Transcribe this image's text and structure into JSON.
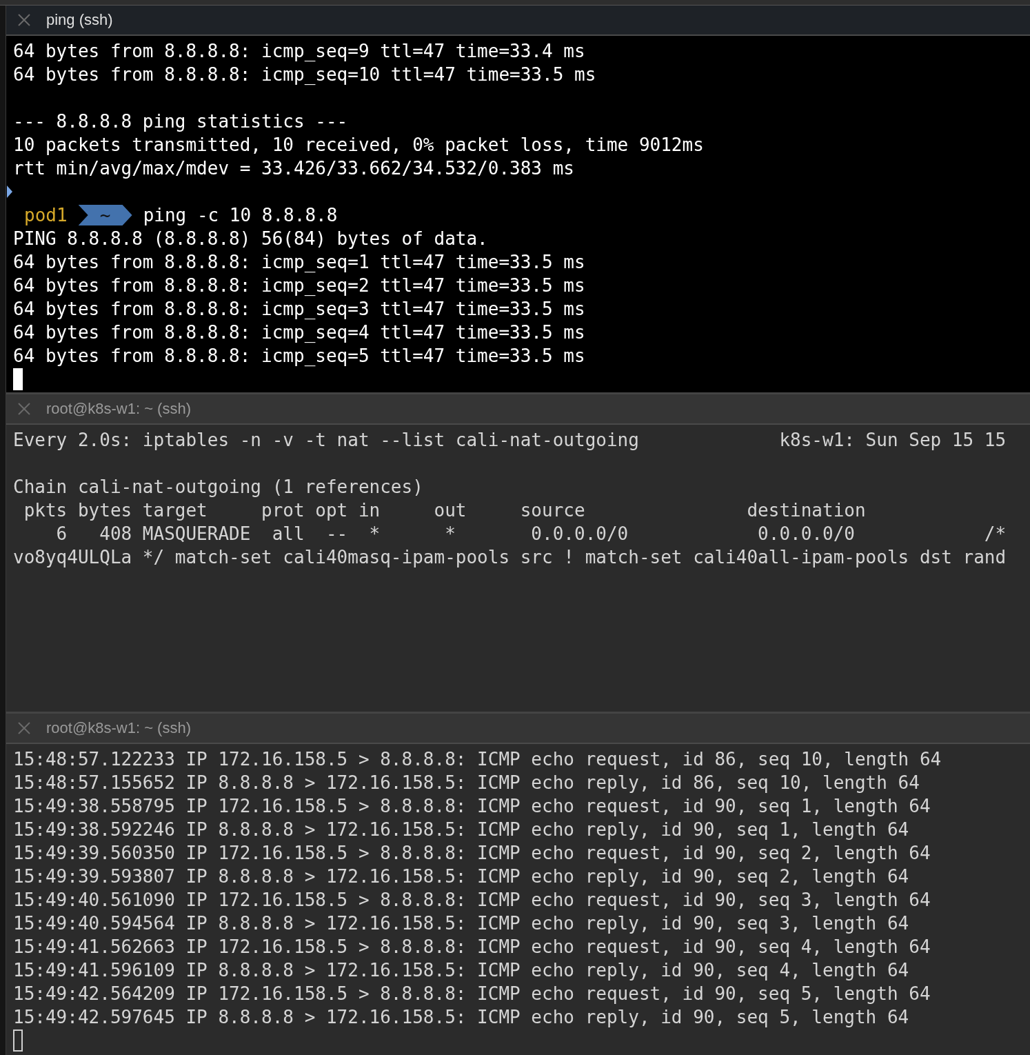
{
  "panes": [
    {
      "title": "ping (ssh)",
      "focused": true,
      "cursor": true,
      "lines": [
        {
          "kind": "text",
          "text": "64 bytes from 8.8.8.8: icmp_seq=9 ttl=47 time=33.4 ms"
        },
        {
          "kind": "text",
          "text": "64 bytes from 8.8.8.8: icmp_seq=10 ttl=47 time=33.5 ms"
        },
        {
          "kind": "blank"
        },
        {
          "kind": "text",
          "text": "--- 8.8.8.8 ping statistics ---"
        },
        {
          "kind": "text",
          "text": "10 packets transmitted, 10 received, 0% packet loss, time 9012ms"
        },
        {
          "kind": "text",
          "text": "rtt min/avg/max/mdev = 33.426/33.662/34.532/0.383 ms"
        },
        {
          "kind": "mark"
        },
        {
          "kind": "prompt",
          "host": "pod1",
          "dir": "~",
          "text": "ping -c 10 8.8.8.8"
        },
        {
          "kind": "text",
          "text": "PING 8.8.8.8 (8.8.8.8) 56(84) bytes of data."
        },
        {
          "kind": "text",
          "text": "64 bytes from 8.8.8.8: icmp_seq=1 ttl=47 time=33.5 ms"
        },
        {
          "kind": "text",
          "text": "64 bytes from 8.8.8.8: icmp_seq=2 ttl=47 time=33.5 ms"
        },
        {
          "kind": "text",
          "text": "64 bytes from 8.8.8.8: icmp_seq=3 ttl=47 time=33.5 ms"
        },
        {
          "kind": "text",
          "text": "64 bytes from 8.8.8.8: icmp_seq=4 ttl=47 time=33.5 ms"
        },
        {
          "kind": "text",
          "text": "64 bytes from 8.8.8.8: icmp_seq=5 ttl=47 time=33.5 ms"
        }
      ]
    },
    {
      "title": "root@k8s-w1: ~ (ssh)",
      "focused": false,
      "cursor": false,
      "lines": [
        {
          "kind": "text",
          "text": "Every 2.0s: iptables -n -v -t nat --list cali-nat-outgoing             k8s-w1: Sun Sep 15 15"
        },
        {
          "kind": "blank"
        },
        {
          "kind": "text",
          "text": "Chain cali-nat-outgoing (1 references)"
        },
        {
          "kind": "text",
          "text": " pkts bytes target     prot opt in     out     source               destination"
        },
        {
          "kind": "text",
          "text": "    6   408 MASQUERADE  all  --  *      *       0.0.0.0/0            0.0.0.0/0            /*"
        },
        {
          "kind": "text",
          "text": "vo8yq4ULQLa */ match-set cali40masq-ipam-pools src ! match-set cali40all-ipam-pools dst rand"
        }
      ]
    },
    {
      "title": "root@k8s-w1: ~ (ssh)",
      "focused": false,
      "cursor": true,
      "lines": [
        {
          "kind": "text",
          "text": "15:48:57.122233 IP 172.16.158.5 > 8.8.8.8: ICMP echo request, id 86, seq 10, length 64"
        },
        {
          "kind": "text",
          "text": "15:48:57.155652 IP 8.8.8.8 > 172.16.158.5: ICMP echo reply, id 86, seq 10, length 64"
        },
        {
          "kind": "text",
          "text": "15:49:38.558795 IP 172.16.158.5 > 8.8.8.8: ICMP echo request, id 90, seq 1, length 64"
        },
        {
          "kind": "text",
          "text": "15:49:38.592246 IP 8.8.8.8 > 172.16.158.5: ICMP echo reply, id 90, seq 1, length 64"
        },
        {
          "kind": "text",
          "text": "15:49:39.560350 IP 172.16.158.5 > 8.8.8.8: ICMP echo request, id 90, seq 2, length 64"
        },
        {
          "kind": "text",
          "text": "15:49:39.593807 IP 8.8.8.8 > 172.16.158.5: ICMP echo reply, id 90, seq 2, length 64"
        },
        {
          "kind": "text",
          "text": "15:49:40.561090 IP 172.16.158.5 > 8.8.8.8: ICMP echo request, id 90, seq 3, length 64"
        },
        {
          "kind": "text",
          "text": "15:49:40.594564 IP 8.8.8.8 > 172.16.158.5: ICMP echo reply, id 90, seq 3, length 64"
        },
        {
          "kind": "text",
          "text": "15:49:41.562663 IP 172.16.158.5 > 8.8.8.8: ICMP echo request, id 90, seq 4, length 64"
        },
        {
          "kind": "text",
          "text": "15:49:41.596109 IP 8.8.8.8 > 172.16.158.5: ICMP echo reply, id 90, seq 4, length 64"
        },
        {
          "kind": "text",
          "text": "15:49:42.564209 IP 172.16.158.5 > 8.8.8.8: ICMP echo request, id 90, seq 5, length 64"
        },
        {
          "kind": "text",
          "text": "15:49:42.597645 IP 8.8.8.8 > 172.16.158.5: ICMP echo reply, id 90, seq 5, length 64"
        }
      ]
    }
  ]
}
